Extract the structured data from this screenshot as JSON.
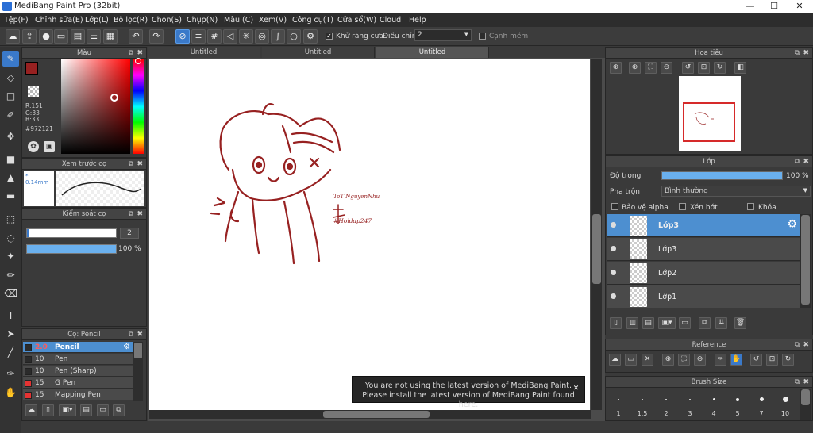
{
  "window": {
    "title": "MediBang Paint Pro (32bit)",
    "min": "—",
    "max": "☐",
    "close": "✕"
  },
  "menu": [
    "Tệp(F)",
    "Chỉnh sửa(E)",
    "Lớp(L)",
    "Bộ lọc(R)",
    "Chọn(S)",
    "Chụp(N)",
    "Màu (C)",
    "Xem(V)",
    "Công cụ(T)",
    "Cửa sổ(W)",
    "Cloud",
    "Help"
  ],
  "toolbar": {
    "antialias_label": "Khử răng cưa",
    "adjust_label": "Điều chỉnh",
    "adjust_value": "2",
    "edge_label": "Cạnh mềm"
  },
  "color_panel": {
    "title": "Màu",
    "r": "R:151",
    "g": "G:33",
    "b": "B:33",
    "hex": "#972121",
    "main_color": "#972121"
  },
  "preview_panel": {
    "title": "Xem trước cọ",
    "size": "0.14mm"
  },
  "brush_control": {
    "title": "Kiểm soát cọ",
    "size": "2",
    "opacity": "100 %",
    "opacity_fraction": 1.0
  },
  "brush_list": {
    "title": "Cọ: Pencil",
    "items": [
      {
        "size": "2.0",
        "name": "Pencil",
        "color": "#2b2b2b"
      },
      {
        "size": "10",
        "name": "Pen",
        "color": "#2b2b2b"
      },
      {
        "size": "10",
        "name": "Pen (Sharp)",
        "color": "#2b2b2b"
      },
      {
        "size": "15",
        "name": "G Pen",
        "color": "#e53333"
      },
      {
        "size": "15",
        "name": "Mapping Pen",
        "color": "#e53333"
      }
    ]
  },
  "tabs": [
    "Untitled",
    "Untitled",
    "Untitled"
  ],
  "canvas": {
    "signature_name": "ToT NguyenNhu",
    "signature_tag": "#Hoidap247",
    "stroke_color": "#972121"
  },
  "notice": {
    "line1": "You are not using the latest version of MediBang Paint.",
    "line2": "Please install the latest version of MediBang Paint found here.",
    "close": "✕"
  },
  "navigator": {
    "title": "Hoa tiêu"
  },
  "layers": {
    "title": "Lớp",
    "opacity_label": "Độ trong",
    "opacity_value": "100 %",
    "opacity_fraction": 1.0,
    "blend_label": "Pha trộn",
    "blend_value": "Bình thường",
    "protect_alpha": "Bảo vệ alpha",
    "clipping": "Xén bớt",
    "lock": "Khóa",
    "items": [
      "Lớp3",
      "Lớp3",
      "Lớp2",
      "Lớp1"
    ]
  },
  "reference": {
    "title": "Reference"
  },
  "brush_size": {
    "title": "Brush Size",
    "sizes": [
      "1",
      "1.5",
      "2",
      "3",
      "4",
      "5",
      "7",
      "10"
    ]
  }
}
